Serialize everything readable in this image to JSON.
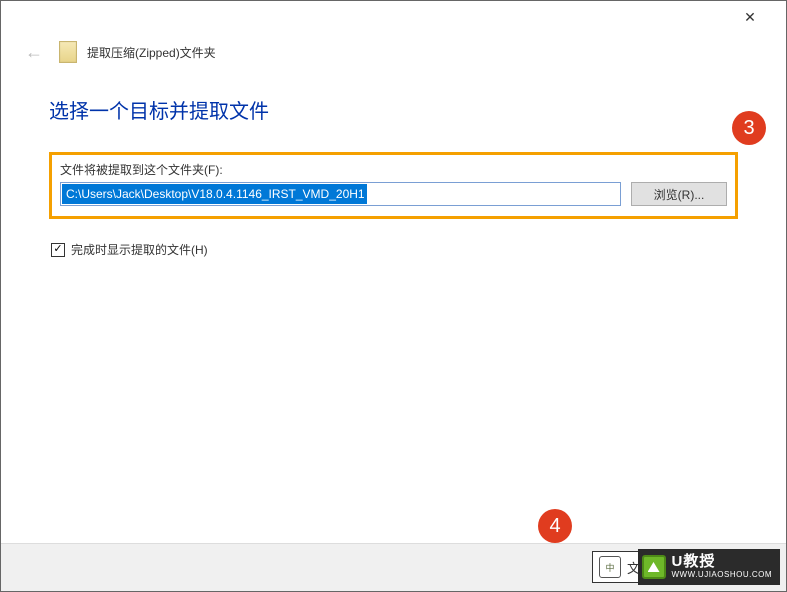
{
  "titlebar": {
    "close": "✕"
  },
  "header": {
    "back_arrow": "←",
    "window_title": "提取压缩(Zipped)文件夹"
  },
  "main": {
    "heading": "选择一个目标并提取文件",
    "field_label": "文件将被提取到这个文件夹(F):",
    "path_value": "C:\\Users\\Jack\\Desktop\\V18.0.4.1146_IRST_VMD_20H1",
    "browse_label": "浏览(R)..."
  },
  "checkbox": {
    "checked_mark": "✓",
    "label": "完成时显示提取的文件(H)"
  },
  "annotations": {
    "badge3": "3",
    "badge4": "4"
  },
  "footer": {
    "ime": "中",
    "text": "文 E,"
  },
  "watermark": {
    "brand": "U教授",
    "url": "WWW.UJIAOSHOU.COM"
  }
}
